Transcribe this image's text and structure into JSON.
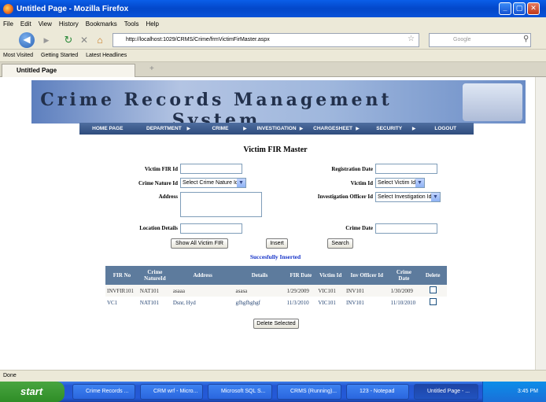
{
  "window": {
    "title": "Untitled Page - Mozilla Firefox"
  },
  "menubar": [
    "File",
    "Edit",
    "View",
    "History",
    "Bookmarks",
    "Tools",
    "Help"
  ],
  "nav": {
    "url": "http://localhost:1029/CRMS/Crime/frmVictimFirMaster.aspx",
    "search_placeholder": "Google"
  },
  "bookmarks": [
    "Most Visited",
    "Getting Started",
    "Latest Headlines"
  ],
  "tab": {
    "label": "Untitled Page"
  },
  "site": {
    "banner_title": "Crime Records Management System",
    "menu": [
      "HOME PAGE",
      "DEPARTMENT",
      "CRIME",
      "INVESTIGATION",
      "CHARGESHEET",
      "SECURITY",
      "LOGOUT"
    ]
  },
  "form": {
    "title": "Victim FIR Master",
    "victim_fir_id_label": "Victim FIR Id",
    "registration_date_label": "Registration Date",
    "crime_nature_id_label": "Crime Nature Id",
    "crime_nature_id_value": "Select Crime Nature Id",
    "victim_id_label": "Victim Id",
    "victim_id_value": "Select Victim Id",
    "address_label": "Address",
    "investigation_officer_label": "Investigation Officer Id",
    "investigation_officer_value": "Select Investigation Id",
    "location_details_label": "Location Details",
    "crime_date_label": "Crime Date",
    "show_all_label": "Show All Victim FIR",
    "insert_label": "Insert",
    "search_label": "Search",
    "success_message": "Succesfully Inserted"
  },
  "grid": {
    "headers": [
      "FIR No",
      "Crime NatureId",
      "Address",
      "Details",
      "FIR Date",
      "Victim Id",
      "Inv Officer Id",
      "Crime Date",
      "Delete"
    ],
    "rows": [
      [
        "INVFIR101",
        "NAT101",
        "asaaa",
        "asasa",
        "1/29/2009",
        "VIC101",
        "INV101",
        "1/30/2009"
      ],
      [
        "VC1",
        "NAT101",
        "Dsnr, Hyd",
        "gfhgfhghgf",
        "11/3/2010",
        "VIC101",
        "INV101",
        "11/10/2010"
      ]
    ],
    "delete_selected_label": "Delete Selected"
  },
  "status": {
    "text": "Done"
  },
  "taskbar": {
    "start_label": "start",
    "tasks": [
      "Crime Records ...",
      "CRM wrf - Micro...",
      "Microsoft SQL S...",
      "CRMS (Running)...",
      "123 - Notepad",
      "Untitled Page - ..."
    ],
    "clock": "3:45 PM"
  }
}
